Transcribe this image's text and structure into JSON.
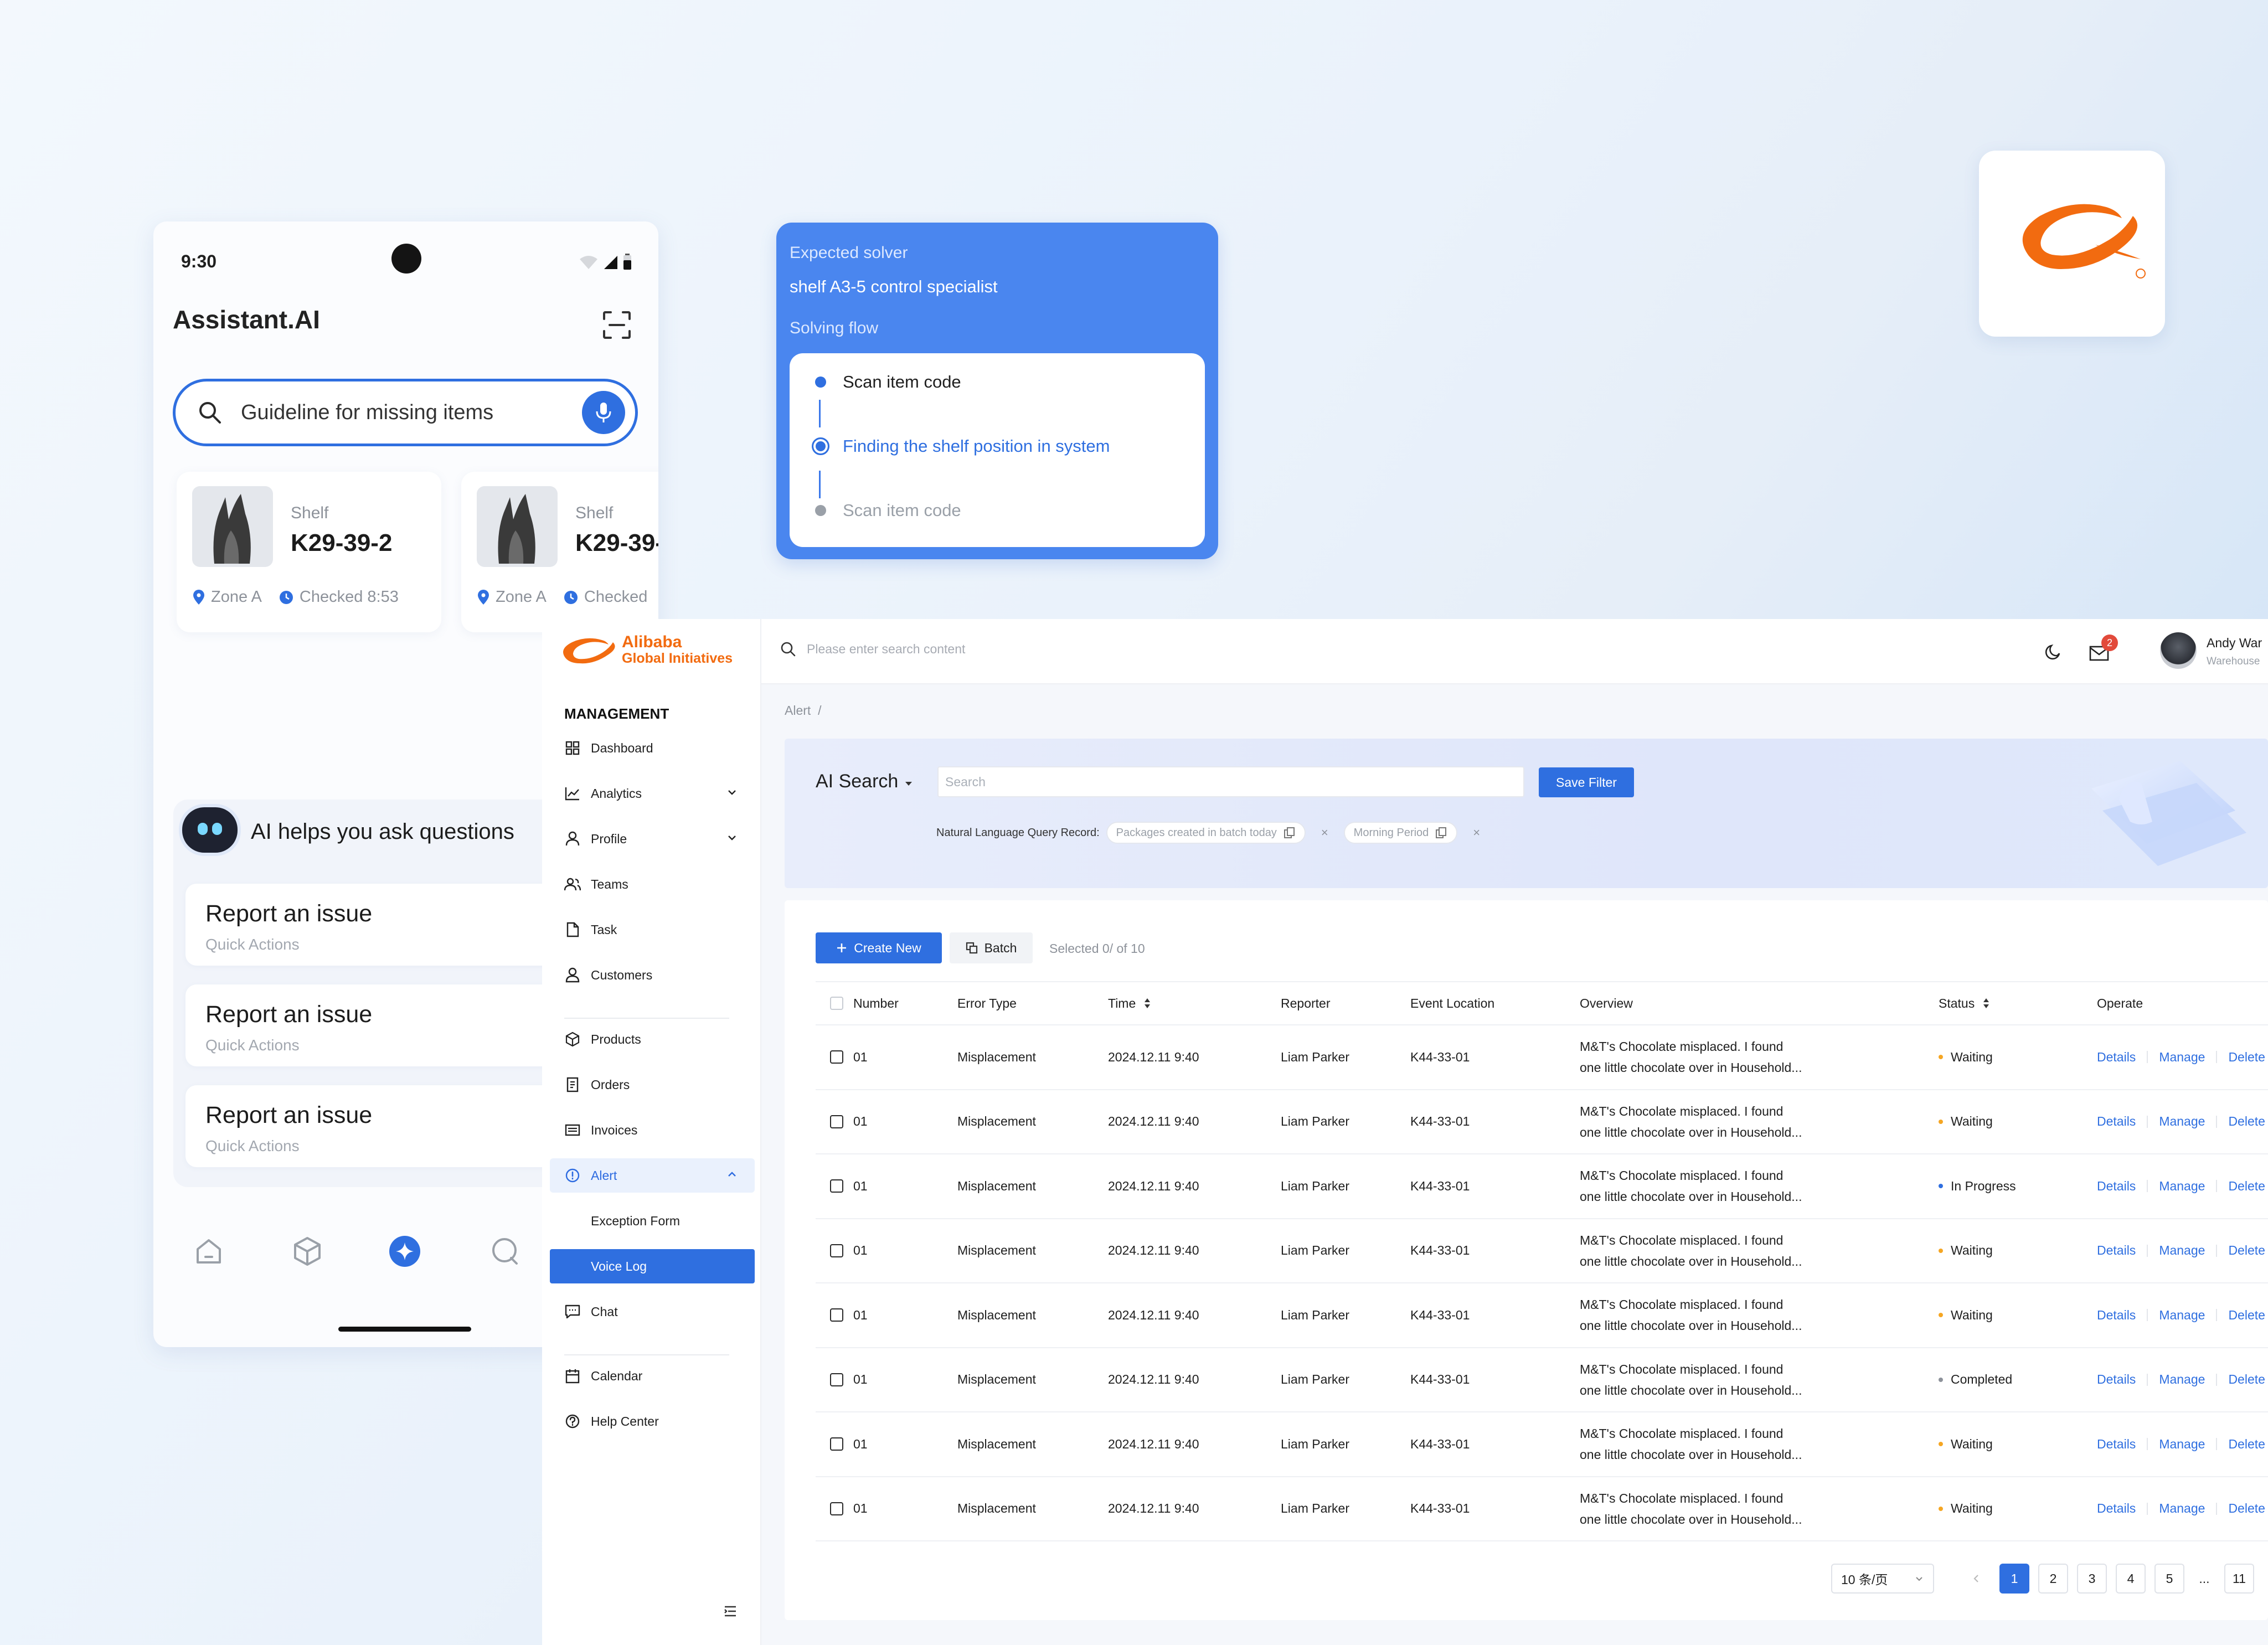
{
  "phone": {
    "status_time": "9:30",
    "app_title": "Assistant.AI",
    "search_query": "Guideline for missing items",
    "shelves": [
      {
        "label": "Shelf",
        "code": "K29-39-2",
        "zone": "Zone A",
        "checked": "Checked 8:53"
      },
      {
        "label": "Shelf",
        "code": "K29-39-",
        "zone": "Zone A",
        "checked": "Checked"
      }
    ],
    "ai_heading": "AI helps you ask questions",
    "issues": [
      {
        "title": "Report an issue",
        "subtitle": "Quick Actions"
      },
      {
        "title": "Report an issue",
        "subtitle": "Quick Actions"
      },
      {
        "title": "Report an issue",
        "subtitle": "Quick Actions"
      }
    ],
    "tabs": [
      {
        "name": "home-icon"
      },
      {
        "name": "box-icon"
      },
      {
        "name": "sparkle-icon"
      },
      {
        "name": "chat-icon"
      }
    ]
  },
  "flow_card": {
    "expected_label": "Expected solver",
    "solver": "shelf A3-5 control specialist",
    "flow_label": "Solving flow",
    "steps": [
      {
        "text": "Scan item code",
        "state": "done"
      },
      {
        "text": "Finding the shelf position in system",
        "state": "current"
      },
      {
        "text": "Scan item code",
        "state": "pending"
      }
    ]
  },
  "brand": {
    "name": "Alibaba",
    "subtitle": "Global Initiatives",
    "color": "#f26b10"
  },
  "sidebar": {
    "section": "MANAGEMENT",
    "items": [
      {
        "label": "Dashboard",
        "icon": "grid-icon"
      },
      {
        "label": "Analytics",
        "icon": "chart-icon",
        "expandable": true
      },
      {
        "label": "Profile",
        "icon": "user-icon",
        "expandable": true
      },
      {
        "label": "Teams",
        "icon": "team-icon"
      },
      {
        "label": "Task",
        "icon": "file-icon"
      },
      {
        "label": "Customers",
        "icon": "customer-icon"
      },
      {
        "label": "Products",
        "icon": "cube-icon"
      },
      {
        "label": "Orders",
        "icon": "order-icon"
      },
      {
        "label": "Invoices",
        "icon": "invoice-icon"
      },
      {
        "label": "Alert",
        "icon": "alert-icon",
        "expanded": true
      },
      {
        "label": "Exception Form",
        "icon": ""
      },
      {
        "label": "Voice Log",
        "icon": ""
      },
      {
        "label": "Chat",
        "icon": "chat-icon"
      },
      {
        "label": "Calendar",
        "icon": "calendar-icon"
      },
      {
        "label": "Help Center",
        "icon": "help-icon"
      }
    ]
  },
  "topbar": {
    "search_placeholder": "Please enter search content",
    "notifications": "2",
    "user_name": "Andy War",
    "user_role": "Warehouse"
  },
  "breadcrumb": {
    "current": "Alert",
    "separator": "/"
  },
  "ai_search": {
    "title": "AI Search",
    "input_placeholder": "Search",
    "save_label": "Save Filter",
    "nl_label": "Natural Language Query Record:",
    "chips": [
      "Packages created in batch today",
      "Morning Period"
    ]
  },
  "toolbar": {
    "create_label": "Create New",
    "batch_label": "Batch",
    "selected_text": "Selected 0/ of 10"
  },
  "table": {
    "headers": [
      "Number",
      "Error Type",
      "Time",
      "Reporter",
      "Event Location",
      "Overview",
      "Status",
      "Operate"
    ],
    "status_colors": {
      "Waiting": "#f5a623",
      "In Progress": "#2f6fe0",
      "Completed": "#8d929a"
    },
    "rows": [
      {
        "number": "01",
        "error": "Misplacement",
        "time": "2024.12.11 9:40",
        "reporter": "Liam Parker",
        "location": "K44-33-01",
        "ov1": "M&T's Chocolate misplaced. I found",
        "ov2": "one little chocolate over in Household...",
        "status": "Waiting"
      },
      {
        "number": "01",
        "error": "Misplacement",
        "time": "2024.12.11 9:40",
        "reporter": "Liam Parker",
        "location": "K44-33-01",
        "ov1": "M&T's Chocolate misplaced. I found",
        "ov2": "one little chocolate over in Household...",
        "status": "Waiting"
      },
      {
        "number": "01",
        "error": "Misplacement",
        "time": "2024.12.11 9:40",
        "reporter": "Liam Parker",
        "location": "K44-33-01",
        "ov1": "M&T's Chocolate misplaced. I found",
        "ov2": "one little chocolate over in Household...",
        "status": "In Progress"
      },
      {
        "number": "01",
        "error": "Misplacement",
        "time": "2024.12.11 9:40",
        "reporter": "Liam Parker",
        "location": "K44-33-01",
        "ov1": "M&T's Chocolate misplaced. I found",
        "ov2": "one little chocolate over in Household...",
        "status": "Waiting"
      },
      {
        "number": "01",
        "error": "Misplacement",
        "time": "2024.12.11 9:40",
        "reporter": "Liam Parker",
        "location": "K44-33-01",
        "ov1": "M&T's Chocolate misplaced. I found",
        "ov2": "one little chocolate over in Household...",
        "status": "Waiting"
      },
      {
        "number": "01",
        "error": "Misplacement",
        "time": "2024.12.11 9:40",
        "reporter": "Liam Parker",
        "location": "K44-33-01",
        "ov1": "M&T's Chocolate misplaced. I found",
        "ov2": "one little chocolate over in Household...",
        "status": "Completed"
      },
      {
        "number": "01",
        "error": "Misplacement",
        "time": "2024.12.11 9:40",
        "reporter": "Liam Parker",
        "location": "K44-33-01",
        "ov1": "M&T's Chocolate misplaced. I found",
        "ov2": "one little chocolate over in Household...",
        "status": "Waiting"
      },
      {
        "number": "01",
        "error": "Misplacement",
        "time": "2024.12.11 9:40",
        "reporter": "Liam Parker",
        "location": "K44-33-01",
        "ov1": "M&T's Chocolate misplaced. I found",
        "ov2": "one little chocolate over in Household...",
        "status": "Waiting"
      }
    ],
    "actions": [
      "Details",
      "Manage",
      "Delete"
    ]
  },
  "pagination": {
    "page_size": "10 条/页",
    "pages": [
      "1",
      "2",
      "3",
      "4",
      "5",
      "...",
      "11"
    ],
    "current": "1"
  }
}
